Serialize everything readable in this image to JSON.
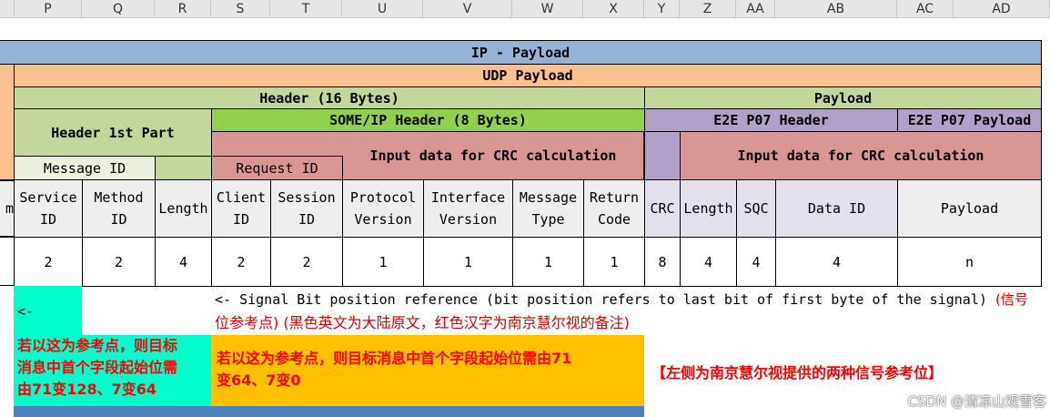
{
  "columns": [
    "P",
    "Q",
    "R",
    "S",
    "T",
    "U",
    "V",
    "W",
    "X",
    "Y",
    "Z",
    "AA",
    "AB",
    "AC",
    "AD"
  ],
  "band_ip": "IP - Payload",
  "band_udp": "UDP Payload",
  "header16": "Header (16 Bytes)",
  "payload": "Payload",
  "header1st": "Header 1st Part",
  "someip": "SOME/IP Header (8 Bytes)",
  "e2e_header": "E2E P07 Header",
  "e2e_payload": "E2E P07 Payload",
  "crc_input_left": "Input data for CRC calculation",
  "crc_input_right": "Input data for CRC calculation",
  "message_id": "Message ID",
  "request_id": "Request ID",
  "partial_left": "m",
  "fields": [
    {
      "l1": "Service",
      "l2": "ID",
      "size": "2"
    },
    {
      "l1": "Method",
      "l2": "ID",
      "size": "2"
    },
    {
      "l1": "Length",
      "l2": "",
      "size": "4"
    },
    {
      "l1": "Client",
      "l2": "ID",
      "size": "2"
    },
    {
      "l1": "Session",
      "l2": "ID",
      "size": "2"
    },
    {
      "l1": "Protocol",
      "l2": "Version",
      "size": "1"
    },
    {
      "l1": "Interface",
      "l2": "Version",
      "size": "1"
    },
    {
      "l1": "Message",
      "l2": "Type",
      "size": "1"
    },
    {
      "l1": "Return",
      "l2": "Code",
      "size": "1"
    },
    {
      "l1": "CRC",
      "l2": "",
      "size": "8"
    },
    {
      "l1": "Length",
      "l2": "",
      "size": "4"
    },
    {
      "l1": "SQC",
      "l2": "",
      "size": "4"
    },
    {
      "l1": "Data ID",
      "l2": "",
      "size": "4"
    },
    {
      "l1": "Payload",
      "l2": "",
      "size": "n"
    }
  ],
  "arrow": "<-",
  "note_black": "<- Signal Bit position reference (bit position refers to last bit of first byte of the signal)",
  "note_red_1": "(信号",
  "note_red_2": "位参考点) (黑色英文为大陆原文，红色汉字为南京慧尔视的备注)",
  "teal_note_l1": "若以这为参考点，则目标",
  "teal_note_l2": "消息中首个字段起始位需",
  "teal_note_l3": "由71变128、7变64",
  "orange_note_l1": "若以这为参考点，则目标消息中首个字段起始位需由71",
  "orange_note_l2": "变64、7变0",
  "side_note": "【左侧为南京慧尔视提供的两种信号参考位】",
  "watermark": "CSDN @清凉山观雪客",
  "colors": {
    "blue": "#95b3d7",
    "peach": "#fac090",
    "light_green": "#c4d79b",
    "bright_green": "#92d050",
    "purple": "#b1a0c7",
    "rose": "#da9694",
    "teal": "#00ffcc",
    "orange": "#ffc000",
    "red": "#ff0000"
  }
}
